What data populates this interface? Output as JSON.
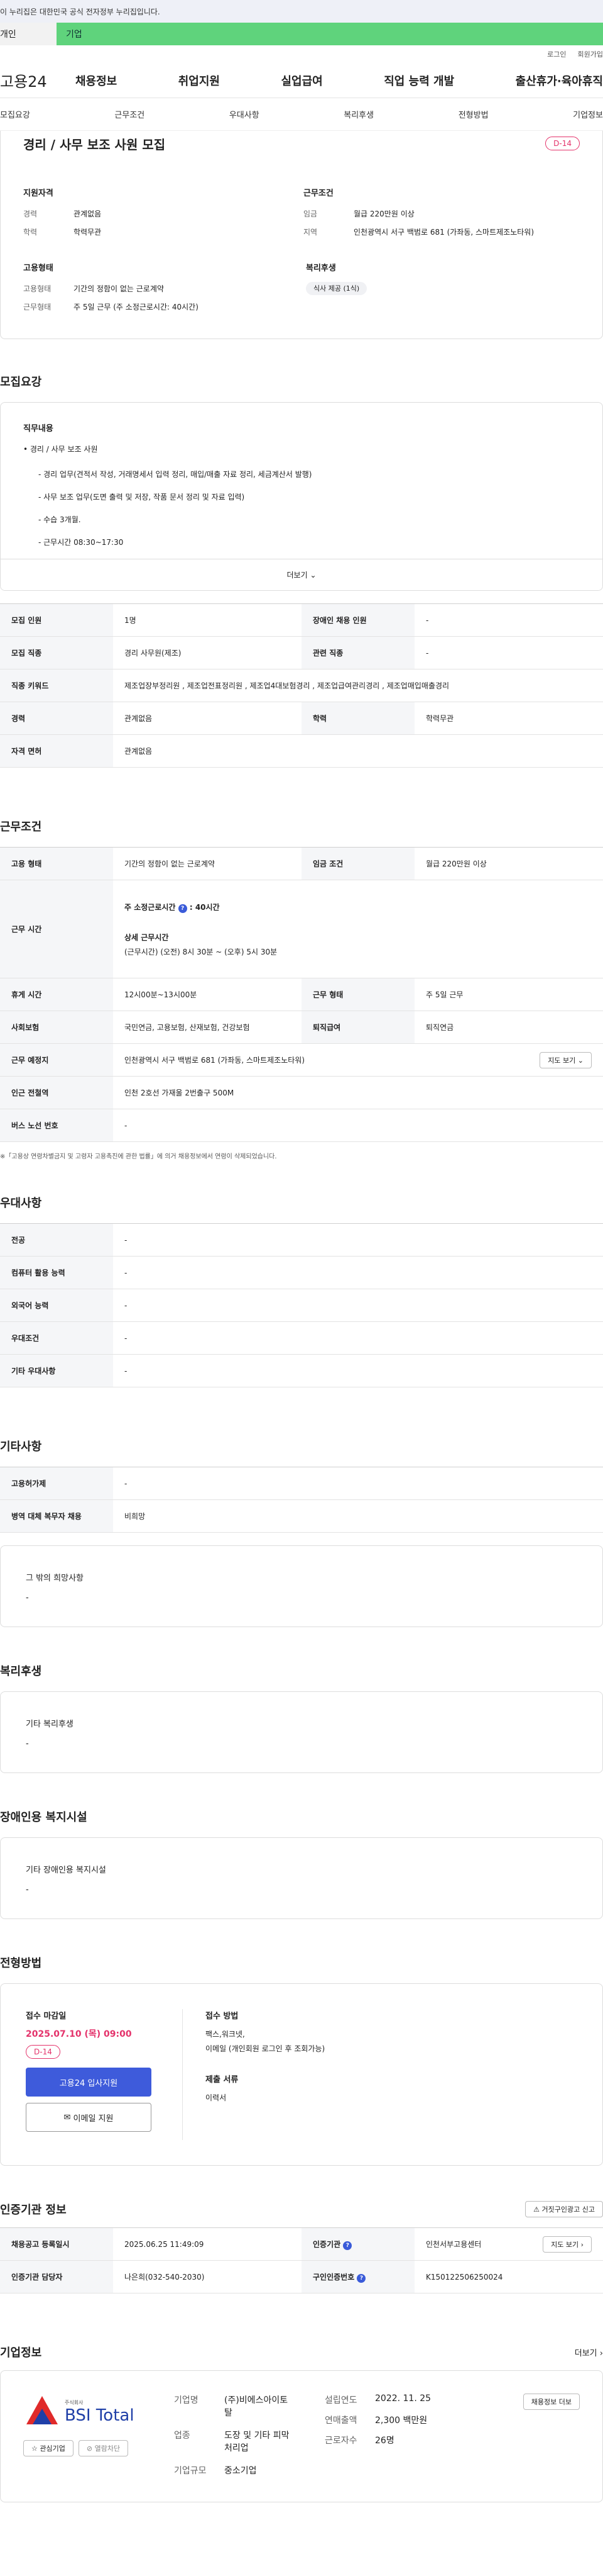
{
  "top_notice": "이 누리집은 대한민국 공식 전자정부 누리집입니다.",
  "seg": {
    "personal": "개인",
    "company": "기업"
  },
  "util": {
    "login": "로그인",
    "join": "회원가입"
  },
  "logo": "고용24",
  "gnb": [
    "채용정보",
    "취업지원",
    "실업급여",
    "직업 능력 개발",
    "출산휴가·육아휴직"
  ],
  "sub": [
    "모집요강",
    "근무조건",
    "우대사항",
    "복리후생",
    "전형방법",
    "기업정보"
  ],
  "summary": {
    "title": "경리 / 사무 보조 사원 모집",
    "dday": "D-14",
    "qual_label": "지원자격",
    "exp_k": "경력",
    "exp_v": "관계없음",
    "edu_k": "학력",
    "edu_v": "학력무관",
    "cond_label": "근무조건",
    "wage_k": "임금",
    "wage_v": "월급 220만원 이상",
    "area_k": "지역",
    "area_v": "인천광역시 서구 백범로 681 (가좌동, 스마트제조노타워)",
    "emp_label": "고용형태",
    "emptype_k": "고용형태",
    "emptype_v": "기간의 정함이 없는 근로계약",
    "worktype_k": "근무형태",
    "worktype_v": "주 5일 근무 (주 소정근로시간: 40시간)",
    "welfare_label": "복리후생",
    "welfare_badge": "식사 제공 (1식)"
  },
  "recruit": {
    "title": "모집요강",
    "duty_label": "직무내용",
    "duty_main": "• 경리 / 사무 보조 사원",
    "duty_items": [
      "- 경리 업무(견적서 작성, 거래명세서 입력 정리, 매입/매출 자료 정리, 세금계산서 발행)",
      "- 사무 보조 업무(도면 출력 및 저장, 작품 문서 정리 및 자료 입력)",
      "- 수습 3개월.",
      "- 근무시간 08:30~17:30"
    ],
    "more": "더보기",
    "rows": [
      {
        "k": "모집 인원",
        "v": "1명",
        "k2": "장애인 채용 인원",
        "v2": "-"
      },
      {
        "k": "모집 직종",
        "v": "경리 사무원(제조)",
        "k2": "관련 직종",
        "v2": "-"
      },
      {
        "k": "직종 키워드",
        "v": "제조업장부정리원 , 제조업전표정리원 , 제조업4대보험경리 , 제조업급여관리경리 , 제조업매입매출경리"
      },
      {
        "k": "경력",
        "v": "관계없음",
        "k2": "학력",
        "v2": "학력무관"
      },
      {
        "k": "자격 면허",
        "v": "관계없음"
      }
    ]
  },
  "work": {
    "title": "근무조건",
    "r1": {
      "k": "고용 형태",
      "v": "기간의 정함이 없는 근로계약",
      "k2": "임금 조건",
      "v2": "월급 220만원 이상"
    },
    "hours_k": "근무 시간",
    "hours_line1": "주 소정근로시간",
    "hours_val": ": 40시간",
    "hours_detail_label": "상세 근무시간",
    "hours_detail": "(근무시간) (오전) 8시 30분 ~ (오후) 5시 30분",
    "r3": {
      "k": "휴게 시간",
      "v": "12시00분~13시00분",
      "k2": "근무 형태",
      "v2": "주 5일 근무"
    },
    "r4": {
      "k": "사회보험",
      "v": "국민연금, 고용보험, 산재보험, 건강보험",
      "k2": "퇴직급여",
      "v2": "퇴직연금"
    },
    "r5": {
      "k": "근무 예정지",
      "v": "인천광역시 서구 백범로 681 (가좌동, 스마트제조노타워)",
      "btn": "지도 보기"
    },
    "r6": {
      "k": "인근 전철역",
      "v": "인천 2호선 가재울 2번출구 500M"
    },
    "r7": {
      "k": "버스 노선 번호",
      "v": "-"
    },
    "note": "※「고용상 연령차별금지 및 고령자 고용촉진에 관한 법률」에 의거 채용정보에서 연령이 삭제되었습니다."
  },
  "prefer": {
    "title": "우대사항",
    "rows": [
      {
        "k": "전공",
        "v": "-"
      },
      {
        "k": "컴퓨터 활용 능력",
        "v": "-"
      },
      {
        "k": "외국어 능력",
        "v": "-"
      },
      {
        "k": "우대조건",
        "v": "-"
      },
      {
        "k": "기타 우대사항",
        "v": "-"
      }
    ]
  },
  "etc": {
    "title": "기타사항",
    "rows": [
      {
        "k": "고용허가제",
        "v": "-"
      },
      {
        "k": "병역 대체 복무자 채용",
        "v": "비희망"
      }
    ],
    "box_label": "그 밖의 희망사항",
    "box_v": "-"
  },
  "welfare": {
    "title": "복리후생",
    "box_label": "기타 복리후생",
    "box_v": "-"
  },
  "disab": {
    "title": "장애인용 복지시설",
    "box_label": "기타 장애인용 복지시설",
    "box_v": "-"
  },
  "apply": {
    "title": "전형방법",
    "deadline_label": "접수 마감일",
    "deadline": "2025.07.10 (목) 09:00",
    "dday": "D-14",
    "btn_apply": "고용24 입사지원",
    "btn_email": "이메일 지원",
    "method_label": "접수 방법",
    "method_v1": "팩스,워크넷,",
    "method_v2": "이메일 (개인회원 로그인 후 조회가능)",
    "docs_label": "제출 서류",
    "docs_v": "이력서"
  },
  "cert": {
    "title": "인증기관 정보",
    "report_btn": "거짓구인광고 신고",
    "r1": {
      "k": "채용공고 등록일시",
      "v": "2025.06.25 11:49:09",
      "k2": "인증기관",
      "v2": "인천서부고용센터",
      "btn": "지도 보기"
    },
    "r2": {
      "k": "인증기관 담당자",
      "v": "나은희(032-540-2030)",
      "k2": "구인인증번호",
      "v2": "K150122506250024"
    }
  },
  "company": {
    "title": "기업정보",
    "more": "더보기",
    "logo_text": "BSI Total",
    "logo_sub": "주식회사",
    "btn_fav": "관심기업",
    "btn_block": "열람차단",
    "name_k": "기업명",
    "name_v": "(주)비에스아이토탈",
    "ind_k": "업종",
    "ind_v": "도장 및 기타 피막 처리업",
    "size_k": "기업규모",
    "size_v": "중소기업",
    "est_k": "설립연도",
    "est_v": "2022. 11. 25",
    "sales_k": "연매출액",
    "sales_v": "2,300 백만원",
    "emp_k": "근로자수",
    "emp_v": "26명",
    "btn_recruit": "채용정보 더보"
  }
}
